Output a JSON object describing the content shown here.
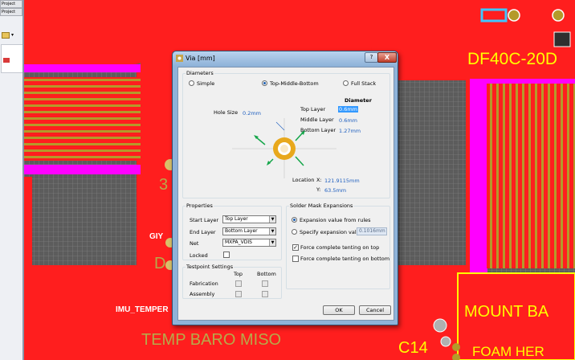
{
  "left_panel": {
    "items": [
      "Project",
      "Project"
    ]
  },
  "pcb": {
    "labels": {
      "connector": "DF40C-20D",
      "gyro": "GIY",
      "imu_temp": "IMU_TEMPER",
      "mirror_bottom": "TEMP   BARO   MISO",
      "cap_ref": "C14",
      "mount": "MOUNT BA",
      "foam": "FOAM HER",
      "pin_num": "3",
      "gnd_letter": "D"
    },
    "colors": {
      "copper": "#ff1e1e",
      "keepout": "#ff00ff",
      "pad": "#b49a2a",
      "grid_bg": "#5a5a5a",
      "silk": "#ffff00"
    }
  },
  "dialog": {
    "title": "Via [mm]",
    "help_label": "?",
    "close_label": "X",
    "diameters": {
      "legend": "Diameters",
      "options": [
        "Simple",
        "Top-Middle-Bottom",
        "Full Stack"
      ],
      "selected": "Top-Middle-Bottom",
      "hole_size_label": "Hole Size",
      "hole_size_value": "0.2mm",
      "diameter_header": "Diameter",
      "top_layer_label": "Top Layer",
      "top_layer_value": "0.6mm",
      "middle_layer_label": "Middle Layer",
      "middle_layer_value": "0.6mm",
      "bottom_layer_label": "Bottom Layer",
      "bottom_layer_value": "1.27mm",
      "location_label": "Location",
      "x_label": "X:",
      "x_value": "121.9115mm",
      "y_label": "Y:",
      "y_value": "63.5mm"
    },
    "properties": {
      "legend": "Properties",
      "start_layer_label": "Start Layer",
      "start_layer_value": "Top Layer",
      "end_layer_label": "End Layer",
      "end_layer_value": "Bottom Layer",
      "net_label": "Net",
      "net_value": "MXPA_VDIS",
      "locked_label": "Locked"
    },
    "solder_mask": {
      "legend": "Solder Mask Expansions",
      "option_rules": "Expansion value from rules",
      "option_specify": "Specify expansion value",
      "specify_value": "0.1016mm",
      "tent_top_label": "Force complete tenting on top",
      "tent_bottom_label": "Force complete tenting on bottom",
      "tent_top_checked": true,
      "tent_bottom_checked": false
    },
    "testpoint": {
      "legend": "Testpoint Settings",
      "col_top": "Top",
      "col_bottom": "Bottom",
      "row_fabrication": "Fabrication",
      "row_assembly": "Assembly"
    },
    "ok_label": "OK",
    "cancel_label": "Cancel"
  }
}
